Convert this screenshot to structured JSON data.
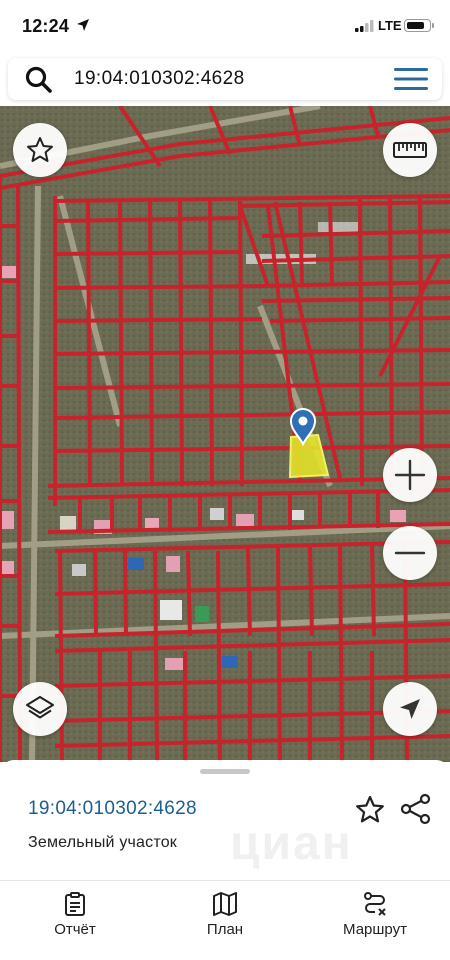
{
  "status_bar": {
    "time": "12:24",
    "network": "LTE"
  },
  "search": {
    "query": "19:04:010302:4628",
    "icon": "search-icon",
    "menu_icon": "hamburger-menu-icon"
  },
  "map": {
    "view": "satellite",
    "overlay": "cadastral-parcels",
    "parcel_color": "#c8232c",
    "selected_parcel_color": "#e3e22a",
    "marker_color": "#2e6fb7",
    "buttons": {
      "favorite": "star-icon",
      "ruler": "ruler-icon",
      "zoom_in": "plus-icon",
      "zoom_out": "minus-icon",
      "layers": "layers-icon",
      "locate": "navigation-arrow-icon"
    }
  },
  "sheet": {
    "cadastral_number": "19:04:010302:4628",
    "object_type": "Земельный участок",
    "watermark": "циан",
    "accent_color": "#1b5f92"
  },
  "tabs": [
    {
      "label": "Отчёт",
      "icon": "clipboard-icon"
    },
    {
      "label": "План",
      "icon": "map-icon"
    },
    {
      "label": "Маршрут",
      "icon": "route-icon"
    }
  ]
}
